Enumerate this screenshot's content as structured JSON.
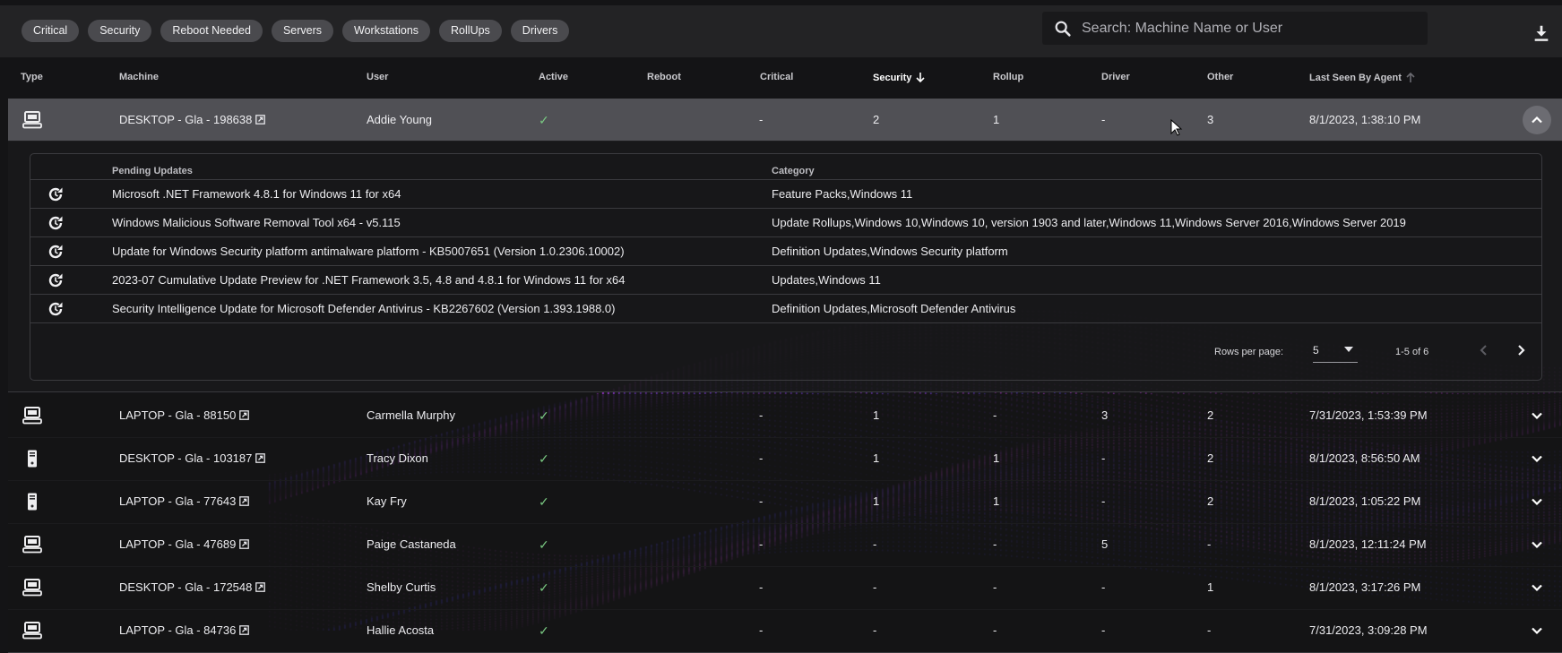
{
  "filters": [
    "Critical",
    "Security",
    "Reboot Needed",
    "Servers",
    "Workstations",
    "RollUps",
    "Drivers"
  ],
  "search": {
    "placeholder": "Search: Machine Name or User",
    "value": ""
  },
  "columns": {
    "type": "Type",
    "machine": "Machine",
    "user": "User",
    "active": "Active",
    "reboot": "Reboot",
    "critical": "Critical",
    "security": "Security",
    "rollup": "Rollup",
    "driver": "Driver",
    "other": "Other",
    "last_seen": "Last Seen By Agent"
  },
  "sort": {
    "column": "Security",
    "direction": "descending"
  },
  "rows": [
    {
      "type": "desktop",
      "machine": "DESKTOP - Gla - 198638",
      "user": "Addie Young",
      "active": "✓",
      "reboot": "",
      "critical": "-",
      "security": "2",
      "rollup": "1",
      "driver": "-",
      "other": "3",
      "last_seen": "8/1/2023, 1:38:10 PM",
      "expanded": true
    },
    {
      "type": "desktop",
      "machine": "LAPTOP - Gla - 88150",
      "user": "Carmella Murphy",
      "active": "✓",
      "reboot": "",
      "critical": "-",
      "security": "1",
      "rollup": "-",
      "driver": "3",
      "other": "2",
      "last_seen": "7/31/2023, 1:53:39 PM",
      "expanded": false
    },
    {
      "type": "tower",
      "machine": "DESKTOP - Gla - 103187",
      "user": "Tracy Dixon",
      "active": "✓",
      "reboot": "",
      "critical": "-",
      "security": "1",
      "rollup": "1",
      "driver": "-",
      "other": "2",
      "last_seen": "8/1/2023, 8:56:50 AM",
      "expanded": false
    },
    {
      "type": "tower",
      "machine": "LAPTOP - Gla - 77643",
      "user": "Kay Fry",
      "active": "✓",
      "reboot": "",
      "critical": "-",
      "security": "1",
      "rollup": "1",
      "driver": "-",
      "other": "2",
      "last_seen": "8/1/2023, 1:05:22 PM",
      "expanded": false
    },
    {
      "type": "desktop",
      "machine": "LAPTOP - Gla - 47689",
      "user": "Paige Castaneda",
      "active": "✓",
      "reboot": "",
      "critical": "-",
      "security": "-",
      "rollup": "-",
      "driver": "5",
      "other": "-",
      "last_seen": "8/1/2023, 12:11:24 PM",
      "expanded": false
    },
    {
      "type": "desktop",
      "machine": "DESKTOP - Gla - 172548",
      "user": "Shelby Curtis",
      "active": "✓",
      "reboot": "",
      "critical": "-",
      "security": "-",
      "rollup": "-",
      "driver": "-",
      "other": "1",
      "last_seen": "8/1/2023, 3:17:26 PM",
      "expanded": false
    },
    {
      "type": "desktop",
      "machine": "LAPTOP - Gla - 84736",
      "user": "Hallie Acosta",
      "active": "✓",
      "reboot": "",
      "critical": "-",
      "security": "-",
      "rollup": "-",
      "driver": "-",
      "other": "-",
      "last_seen": "7/31/2023, 3:09:28 PM",
      "expanded": false
    }
  ],
  "details": {
    "pending_header": "Pending Updates",
    "category_header": "Category",
    "updates": [
      {
        "name": "Microsoft .NET Framework 4.8.1 for Windows 11 for x64",
        "category": "Feature Packs,Windows 11"
      },
      {
        "name": "Windows Malicious Software Removal Tool x64 - v5.115",
        "category": "Update Rollups,Windows 10,Windows 10, version 1903 and later,Windows 11,Windows Server 2016,Windows Server 2019"
      },
      {
        "name": "Update for Windows Security platform antimalware platform - KB5007651 (Version 1.0.2306.10002)",
        "category": "Definition Updates,Windows Security platform"
      },
      {
        "name": "2023-07 Cumulative Update Preview for .NET Framework 3.5, 4.8 and 4.8.1 for Windows 11 for x64",
        "category": "Updates,Windows 11"
      },
      {
        "name": "Security Intelligence Update for Microsoft Defender Antivirus - KB2267602 (Version 1.393.1988.0)",
        "category": "Definition Updates,Microsoft Defender Antivirus"
      }
    ],
    "pagination": {
      "rows_per_page_label": "Rows per page:",
      "rows_per_page": "5",
      "range": "1-5 of 6"
    }
  },
  "icons": {
    "search": "search-icon",
    "download": "download-icon",
    "desktop": "desktop-icon",
    "tower": "tower-icon",
    "external": "external-link-icon",
    "refresh": "refresh-icon",
    "chevron_up": "chevron-up-icon",
    "chevron_down": "chevron-down-icon",
    "prev": "chevron-left-icon",
    "next": "chevron-right-icon"
  },
  "colors": {
    "background": "#141416",
    "row_expanded": "#505055",
    "chip": "#4a4a4e",
    "check": "#79c781",
    "wave_purple": "#b43ad6",
    "wave_blue": "#5a3fd0"
  }
}
